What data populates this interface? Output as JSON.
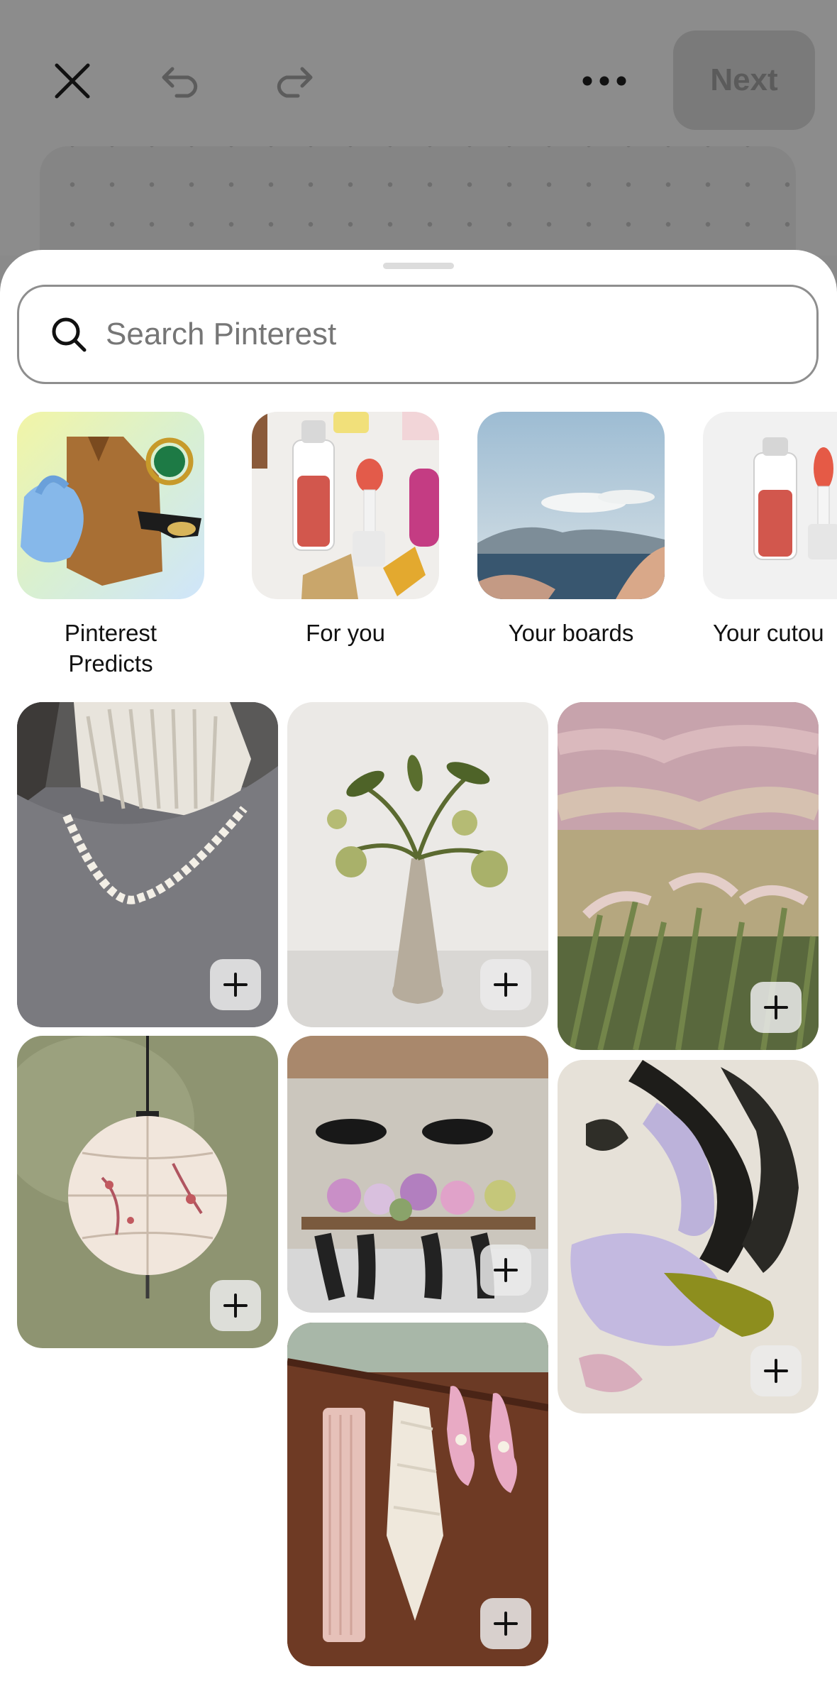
{
  "toolbar": {
    "close_icon": "close-icon",
    "undo_icon": "undo-icon",
    "redo_icon": "redo-icon",
    "more_icon": "more-icon",
    "next_label": "Next"
  },
  "search": {
    "placeholder": "Search Pinterest",
    "value": ""
  },
  "categories": [
    {
      "label": "Pinterest\nPredicts"
    },
    {
      "label": "For you"
    },
    {
      "label": "Your boards"
    },
    {
      "label": "Your cutou"
    }
  ],
  "pins": [
    {
      "name": "pearl-necklace-pin"
    },
    {
      "name": "vase-flowers-pin"
    },
    {
      "name": "pink-grass-pin"
    },
    {
      "name": "paper-lantern-pin"
    },
    {
      "name": "dining-room-pin"
    },
    {
      "name": "abstract-painting-pin"
    },
    {
      "name": "pink-shoes-pin"
    }
  ],
  "colors": {
    "sheet": "#ffffff",
    "dim": "#8c8c8c",
    "text": "#111111"
  }
}
